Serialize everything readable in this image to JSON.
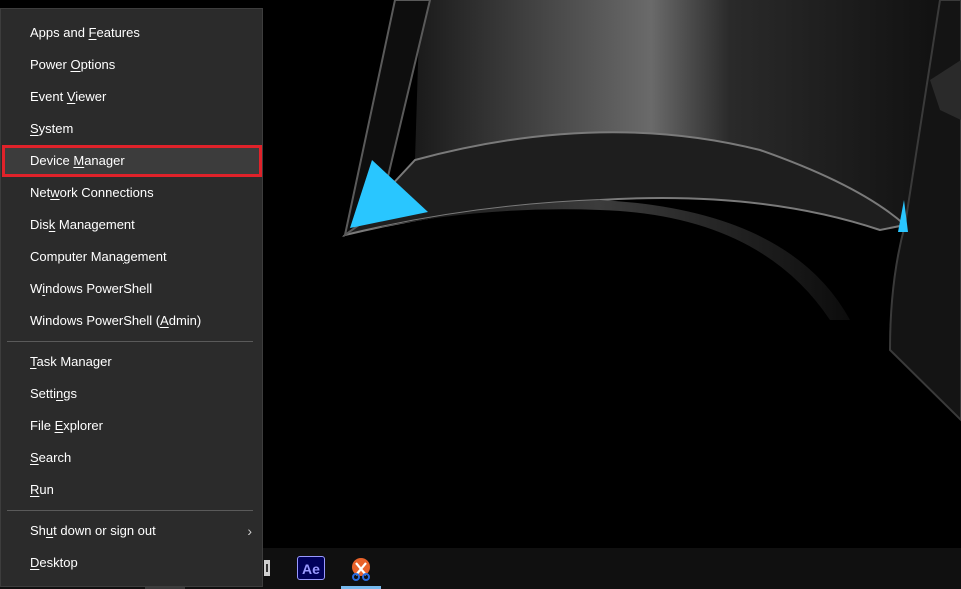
{
  "menu": {
    "groups": [
      [
        {
          "pre": "Apps and ",
          "key": "F",
          "post": "eatures"
        },
        {
          "pre": "Power ",
          "key": "O",
          "post": "ptions"
        },
        {
          "pre": "Event ",
          "key": "V",
          "post": "iewer"
        },
        {
          "pre": "",
          "key": "S",
          "post": "ystem"
        },
        {
          "pre": "Device ",
          "key": "M",
          "post": "anager",
          "highlighted": true
        },
        {
          "pre": "Net",
          "key": "w",
          "post": "ork Connections"
        },
        {
          "pre": "Dis",
          "key": "k",
          "post": " Management"
        },
        {
          "pre": "Computer Mana",
          "key": "g",
          "post": "ement"
        },
        {
          "pre": "W",
          "key": "i",
          "post": "ndows PowerShell"
        },
        {
          "pre": "Windows PowerShell (",
          "key": "A",
          "post": "dmin)"
        }
      ],
      [
        {
          "pre": "",
          "key": "T",
          "post": "ask Manager"
        },
        {
          "pre": "Setti",
          "key": "n",
          "post": "gs"
        },
        {
          "pre": "File ",
          "key": "E",
          "post": "xplorer"
        },
        {
          "pre": "",
          "key": "S",
          "post": "earch"
        },
        {
          "pre": "",
          "key": "R",
          "post": "un"
        }
      ],
      [
        {
          "pre": "Sh",
          "key": "u",
          "post": "t down or sign out",
          "submenu": true
        },
        {
          "pre": "",
          "key": "D",
          "post": "esktop"
        }
      ]
    ],
    "highlight_color": "#e0222a",
    "submenu_icon": "chevron-right-icon"
  },
  "taskbar": {
    "apps": [
      {
        "name": "after-effects-icon",
        "label": "Ae"
      },
      {
        "name": "snipping-tool-icon"
      }
    ]
  },
  "wallpaper": {
    "accent": "#29c6ff"
  }
}
